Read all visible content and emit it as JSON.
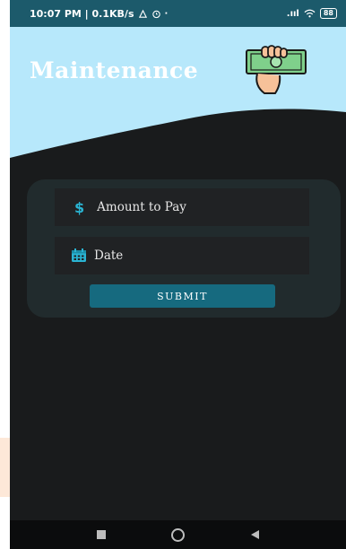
{
  "status_bar": {
    "time_info": "10:07 PM | 0.1KB/s",
    "signal": ".ııl",
    "battery": "88"
  },
  "header": {
    "title": "Maintenance",
    "icon": "hand-holding-money-icon",
    "colors": {
      "sky": "#b7e8fb",
      "dark": "#191b1c"
    }
  },
  "form": {
    "amount": {
      "icon": "dollar-icon",
      "placeholder": "Amount to Pay"
    },
    "date": {
      "icon": "calendar-icon",
      "placeholder": "Date"
    },
    "submit_label": "SUBMIT",
    "accent": "#166a7f"
  },
  "nav": {
    "items": [
      "recents-button",
      "home-button",
      "back-button"
    ]
  }
}
